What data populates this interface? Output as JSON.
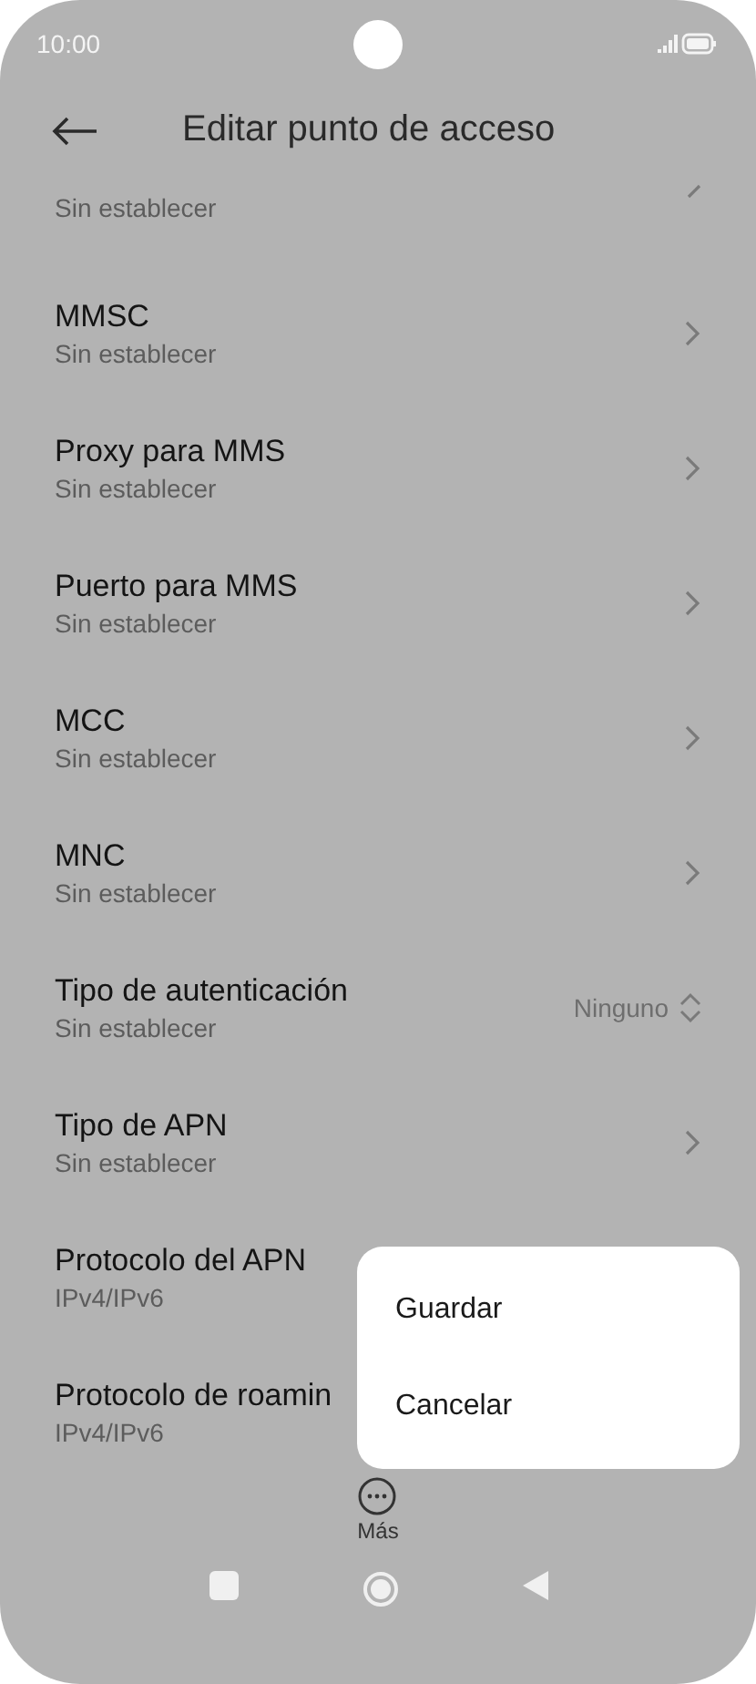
{
  "status_bar": {
    "time": "10:00"
  },
  "header": {
    "title": "Editar punto de acceso"
  },
  "items": [
    {
      "kind": "partial",
      "subtitle": "Sin establecer"
    },
    {
      "kind": "nav",
      "title": "MMSC",
      "subtitle": "Sin establecer"
    },
    {
      "kind": "nav",
      "title": "Proxy para MMS",
      "subtitle": "Sin establecer"
    },
    {
      "kind": "nav",
      "title": "Puerto para MMS",
      "subtitle": "Sin establecer"
    },
    {
      "kind": "nav",
      "title": "MCC",
      "subtitle": "Sin establecer"
    },
    {
      "kind": "nav",
      "title": "MNC",
      "subtitle": "Sin establecer"
    },
    {
      "kind": "select",
      "title": "Tipo de autenticación",
      "subtitle": "Sin establecer",
      "value": "Ninguno"
    },
    {
      "kind": "nav",
      "title": "Tipo de APN",
      "subtitle": "Sin establecer"
    },
    {
      "kind": "plain",
      "title": "Protocolo del APN",
      "subtitle": "IPv4/IPv6"
    },
    {
      "kind": "plain",
      "title": "Protocolo de roamin",
      "subtitle": "IPv4/IPv6"
    }
  ],
  "popup_menu": [
    "Guardar",
    "Cancelar"
  ],
  "toolbar": {
    "more_label": "Más"
  }
}
